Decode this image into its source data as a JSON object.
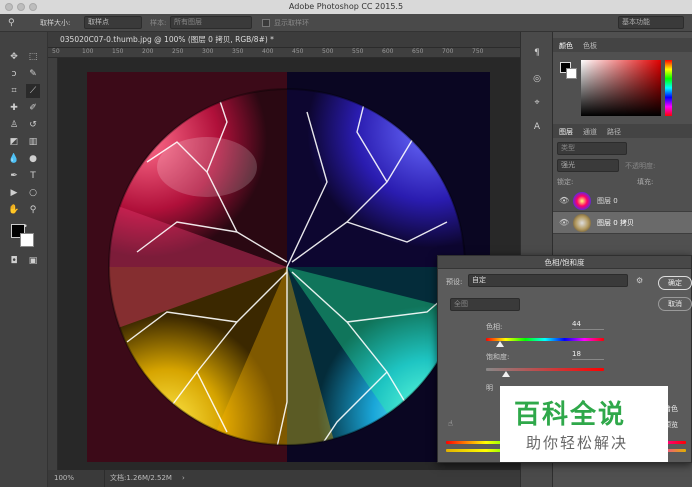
{
  "window": {
    "title": "Adobe Photoshop CC 2015.5"
  },
  "options": {
    "sample_size_label": "取样大小:",
    "sample_size_value": "取样点",
    "sample_label": "样本:",
    "sample_value": "所有图层",
    "show_ring_label": "显示取样环",
    "workspace": "基本功能"
  },
  "document": {
    "tab_title": "035020C07-0.thumb.jpg @ 100% (图层 0 拷贝, RGB/8#) *",
    "ruler_ticks": [
      "50",
      "100",
      "150",
      "200",
      "250",
      "300",
      "350",
      "400",
      "450",
      "500",
      "550",
      "600",
      "650",
      "700",
      "750"
    ]
  },
  "status": {
    "zoom": "100%",
    "doc_size": "文档:1.26M/2.52M",
    "arrow": "›"
  },
  "color_panel": {
    "tab_color": "颜色",
    "tab_swatches": "色板",
    "accent": "#e00000"
  },
  "layers_panel": {
    "tab_layers": "图层",
    "tab_channels": "通道",
    "tab_paths": "路径",
    "kind_placeholder": "类型",
    "blend_mode": "强光",
    "opacity_label": "不透明度:",
    "lock_label": "锁定:",
    "fill_label": "填充:",
    "layers": [
      {
        "name": "图层 0"
      },
      {
        "name": "图层 0 拷贝"
      }
    ]
  },
  "dialog": {
    "title": "色相/饱和度",
    "preset_label": "预设:",
    "preset_value": "自定",
    "channel_value": "全图",
    "ok_label": "确定",
    "cancel_label": "取消",
    "hue_label": "色相:",
    "hue_value": "44",
    "sat_label": "饱和度:",
    "sat_value": "18",
    "light_label": "明",
    "colorize_label": "着色",
    "preview_label": "预览"
  },
  "watermark": {
    "main": "百科全说",
    "sub": "助你轻松解决"
  }
}
